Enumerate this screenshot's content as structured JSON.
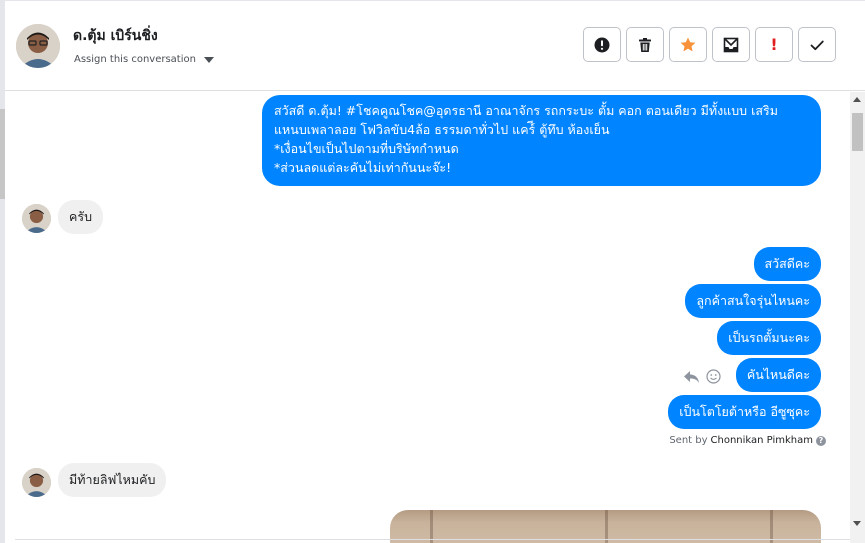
{
  "header": {
    "contact_name": "ด.ตุ้ม เบิร์นชิ่ง",
    "assign_label": "Assign this conversation",
    "actions": [
      {
        "name": "spam-button",
        "icon": "alert-circle-icon"
      },
      {
        "name": "delete-button",
        "icon": "trash-icon"
      },
      {
        "name": "star-button",
        "icon": "star-icon"
      },
      {
        "name": "mark-unread-button",
        "icon": "envelope-icon"
      },
      {
        "name": "follow-up-button",
        "icon": "exclamation-icon",
        "glyph": "!"
      },
      {
        "name": "done-button",
        "icon": "checkmark-icon"
      }
    ]
  },
  "messages": {
    "outgoing_long": [
      "สวัสดี ด.ตุ้ม! #โชคคูณโชค@อุดรธานี อาณาจักร รถกระบะ ตั้ม คอก ตอนเดียว มีทั้งแบบ เสริม",
      "แหนบเพลาลอย โฟวิลขับ4ล้อ ธรรมดาทั่วไป แคร์ี ตู้ทึบ ห้องเย็น",
      "*เงื่อนไขเป็นไปตามที่บริษัทกำหนด",
      "*ส่วนลดแต่ละคันไม่เท่ากันนะจ๊ะ!"
    ],
    "incoming_1": "ครับ",
    "outgoing_short": [
      "สวัสดีคะ",
      "ลูกค้าสนใจรุ่นไหนคะ",
      "เป็นรถตั้มนะคะ",
      "คันไหนดีคะ",
      "เป็นโตโยต้าหรือ อีซูซุคะ"
    ],
    "sent_by_prefix": "Sent by",
    "sent_by_name": "Chonnikan Pimkham",
    "help_glyph": "?",
    "incoming_2": "มีท้ายลิฟไหมคับ"
  },
  "colors": {
    "outgoing_bubble": "#0084ff",
    "incoming_bubble": "#f0f0f0",
    "star": "#f7923a",
    "follow_up": "#e02020"
  }
}
